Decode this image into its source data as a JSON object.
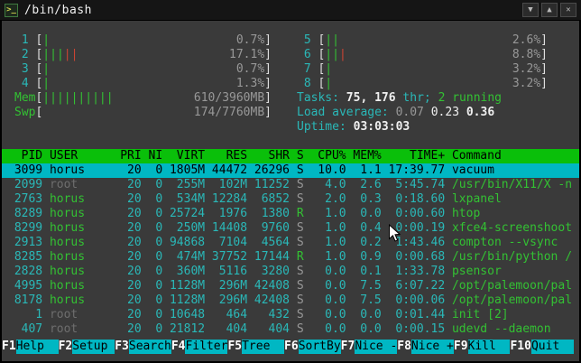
{
  "palette": {
    "term_bg": "#3a3a3a",
    "titlebar_bg": "#151515",
    "cyan": "#2ab8b8",
    "green": "#33c133",
    "red": "#cc4433",
    "gray": "#989898",
    "dim": "#6e6e6e",
    "white": "#efefef",
    "header_bg": "#0abf0a",
    "selected_bg": "#00b7c3",
    "fkey_bg": "#00b7c3"
  },
  "window": {
    "title": "/bin/bash",
    "buttons": [
      {
        "name": "shade",
        "glyph": "▼"
      },
      {
        "name": "maximize",
        "glyph": "▲"
      },
      {
        "name": "close",
        "glyph": "✕"
      }
    ]
  },
  "meters_left": [
    {
      "label": "1",
      "value": "0.7%",
      "segments": [
        {
          "color": "green",
          "bars": 1
        }
      ]
    },
    {
      "label": "2",
      "value": "17.1%",
      "segments": [
        {
          "color": "green",
          "bars": 3
        },
        {
          "color": "red",
          "bars": 2
        }
      ]
    },
    {
      "label": "3",
      "value": "0.7%",
      "segments": [
        {
          "color": "green",
          "bars": 1
        }
      ]
    },
    {
      "label": "4",
      "value": "1.3%",
      "segments": [
        {
          "color": "green",
          "bars": 1
        }
      ]
    },
    {
      "label": "Mem",
      "value": "610/3960MB",
      "segments": [
        {
          "color": "green",
          "bars": 10
        }
      ]
    },
    {
      "label": "Swp",
      "value": "174/7760MB",
      "segments": []
    }
  ],
  "meters_right": [
    {
      "label": "5",
      "value": "2.6%",
      "segments": [
        {
          "color": "green",
          "bars": 2
        }
      ]
    },
    {
      "label": "6",
      "value": "8.8%",
      "segments": [
        {
          "color": "green",
          "bars": 2
        },
        {
          "color": "red",
          "bars": 1
        }
      ]
    },
    {
      "label": "7",
      "value": "3.2%",
      "segments": [
        {
          "color": "green",
          "bars": 1
        }
      ]
    },
    {
      "label": "8",
      "value": "3.2%",
      "segments": [
        {
          "color": "green",
          "bars": 1
        }
      ]
    }
  ],
  "stats": {
    "tasks": [
      {
        "text": "Tasks: ",
        "color": "cyan"
      },
      {
        "text": "75, ",
        "color": "white",
        "bold": true
      },
      {
        "text": "176 ",
        "color": "white",
        "bold": true
      },
      {
        "text": "thr; ",
        "color": "cyan"
      },
      {
        "text": "2 running",
        "color": "green"
      }
    ],
    "load": [
      {
        "text": "Load average: ",
        "color": "cyan"
      },
      {
        "text": "0.07 ",
        "color": "gray"
      },
      {
        "text": "0.23 ",
        "color": "white"
      },
      {
        "text": "0.36",
        "color": "white",
        "bold": true
      }
    ],
    "uptime": [
      {
        "text": "Uptime: ",
        "color": "cyan"
      },
      {
        "text": "03:03:03",
        "color": "white",
        "bold": true
      }
    ]
  },
  "table": {
    "columns": [
      {
        "key": "pid",
        "label": "PID"
      },
      {
        "key": "user",
        "label": "USER"
      },
      {
        "key": "pri",
        "label": "PRI"
      },
      {
        "key": "ni",
        "label": "NI"
      },
      {
        "key": "virt",
        "label": "VIRT"
      },
      {
        "key": "res",
        "label": "RES"
      },
      {
        "key": "shr",
        "label": "SHR"
      },
      {
        "key": "s",
        "label": "S"
      },
      {
        "key": "cpu",
        "label": "CPU%"
      },
      {
        "key": "mem",
        "label": "MEM%"
      },
      {
        "key": "time",
        "label": "TIME+"
      },
      {
        "key": "cmd",
        "label": "Command"
      }
    ],
    "rows": [
      {
        "pid": "3099",
        "user": "horus",
        "pri": "20",
        "ni": "0",
        "virt": "1805M",
        "res": "44472",
        "shr": "26296",
        "s": "S",
        "cpu": "10.0",
        "mem": "1.1",
        "time": "17:39.77",
        "cmd": "vacuum",
        "selected": true
      },
      {
        "pid": "2099",
        "user": "root",
        "pri": "20",
        "ni": "0",
        "virt": "255M",
        "res": "102M",
        "shr": "11252",
        "s": "S",
        "cpu": "4.0",
        "mem": "2.6",
        "time": "5:45.74",
        "cmd": "/usr/bin/X11/X -n"
      },
      {
        "pid": "2763",
        "user": "horus",
        "pri": "20",
        "ni": "0",
        "virt": "534M",
        "res": "12284",
        "shr": "6852",
        "s": "S",
        "cpu": "2.0",
        "mem": "0.3",
        "time": "0:18.60",
        "cmd": "lxpanel"
      },
      {
        "pid": "8289",
        "user": "horus",
        "pri": "20",
        "ni": "0",
        "virt": "25724",
        "res": "1976",
        "shr": "1380",
        "s": "R",
        "cpu": "1.0",
        "mem": "0.0",
        "time": "0:00.60",
        "cmd": "htop"
      },
      {
        "pid": "8299",
        "user": "horus",
        "pri": "20",
        "ni": "0",
        "virt": "250M",
        "res": "14408",
        "shr": "9760",
        "s": "S",
        "cpu": "1.0",
        "mem": "0.4",
        "time": "0:00.19",
        "cmd": "xfce4-screenshoot"
      },
      {
        "pid": "2913",
        "user": "horus",
        "pri": "20",
        "ni": "0",
        "virt": "94868",
        "res": "7104",
        "shr": "4564",
        "s": "S",
        "cpu": "1.0",
        "mem": "0.2",
        "time": "1:43.46",
        "cmd": "compton --vsync"
      },
      {
        "pid": "8285",
        "user": "horus",
        "pri": "20",
        "ni": "0",
        "virt": "474M",
        "res": "37752",
        "shr": "17144",
        "s": "R",
        "cpu": "1.0",
        "mem": "0.9",
        "time": "0:00.68",
        "cmd": "/usr/bin/python /"
      },
      {
        "pid": "2828",
        "user": "horus",
        "pri": "20",
        "ni": "0",
        "virt": "360M",
        "res": "5116",
        "shr": "3280",
        "s": "S",
        "cpu": "0.0",
        "mem": "0.1",
        "time": "1:33.78",
        "cmd": "psensor"
      },
      {
        "pid": "4995",
        "user": "horus",
        "pri": "20",
        "ni": "0",
        "virt": "1128M",
        "res": "296M",
        "shr": "42408",
        "s": "S",
        "cpu": "0.0",
        "mem": "7.5",
        "time": "6:07.22",
        "cmd": "/opt/palemoon/pal"
      },
      {
        "pid": "8178",
        "user": "horus",
        "pri": "20",
        "ni": "0",
        "virt": "1128M",
        "res": "296M",
        "shr": "42408",
        "s": "S",
        "cpu": "0.0",
        "mem": "7.5",
        "time": "0:00.06",
        "cmd": "/opt/palemoon/pal"
      },
      {
        "pid": "1",
        "user": "root",
        "pri": "20",
        "ni": "0",
        "virt": "10648",
        "res": "464",
        "shr": "432",
        "s": "S",
        "cpu": "0.0",
        "mem": "0.0",
        "time": "0:01.44",
        "cmd": "init [2]"
      },
      {
        "pid": "407",
        "user": "root",
        "pri": "20",
        "ni": "0",
        "virt": "21812",
        "res": "404",
        "shr": "404",
        "s": "S",
        "cpu": "0.0",
        "mem": "0.0",
        "time": "0:00.15",
        "cmd": "udevd --daemon"
      }
    ]
  },
  "fkeys": [
    {
      "key": "F1",
      "label": "Help"
    },
    {
      "key": "F2",
      "label": "Setup"
    },
    {
      "key": "F3",
      "label": "Search"
    },
    {
      "key": "F4",
      "label": "Filter"
    },
    {
      "key": "F5",
      "label": "Tree"
    },
    {
      "key": "F6",
      "label": "SortBy"
    },
    {
      "key": "F7",
      "label": "Nice -"
    },
    {
      "key": "F8",
      "label": "Nice +"
    },
    {
      "key": "F9",
      "label": "Kill"
    },
    {
      "key": "F10",
      "label": "Quit"
    }
  ]
}
